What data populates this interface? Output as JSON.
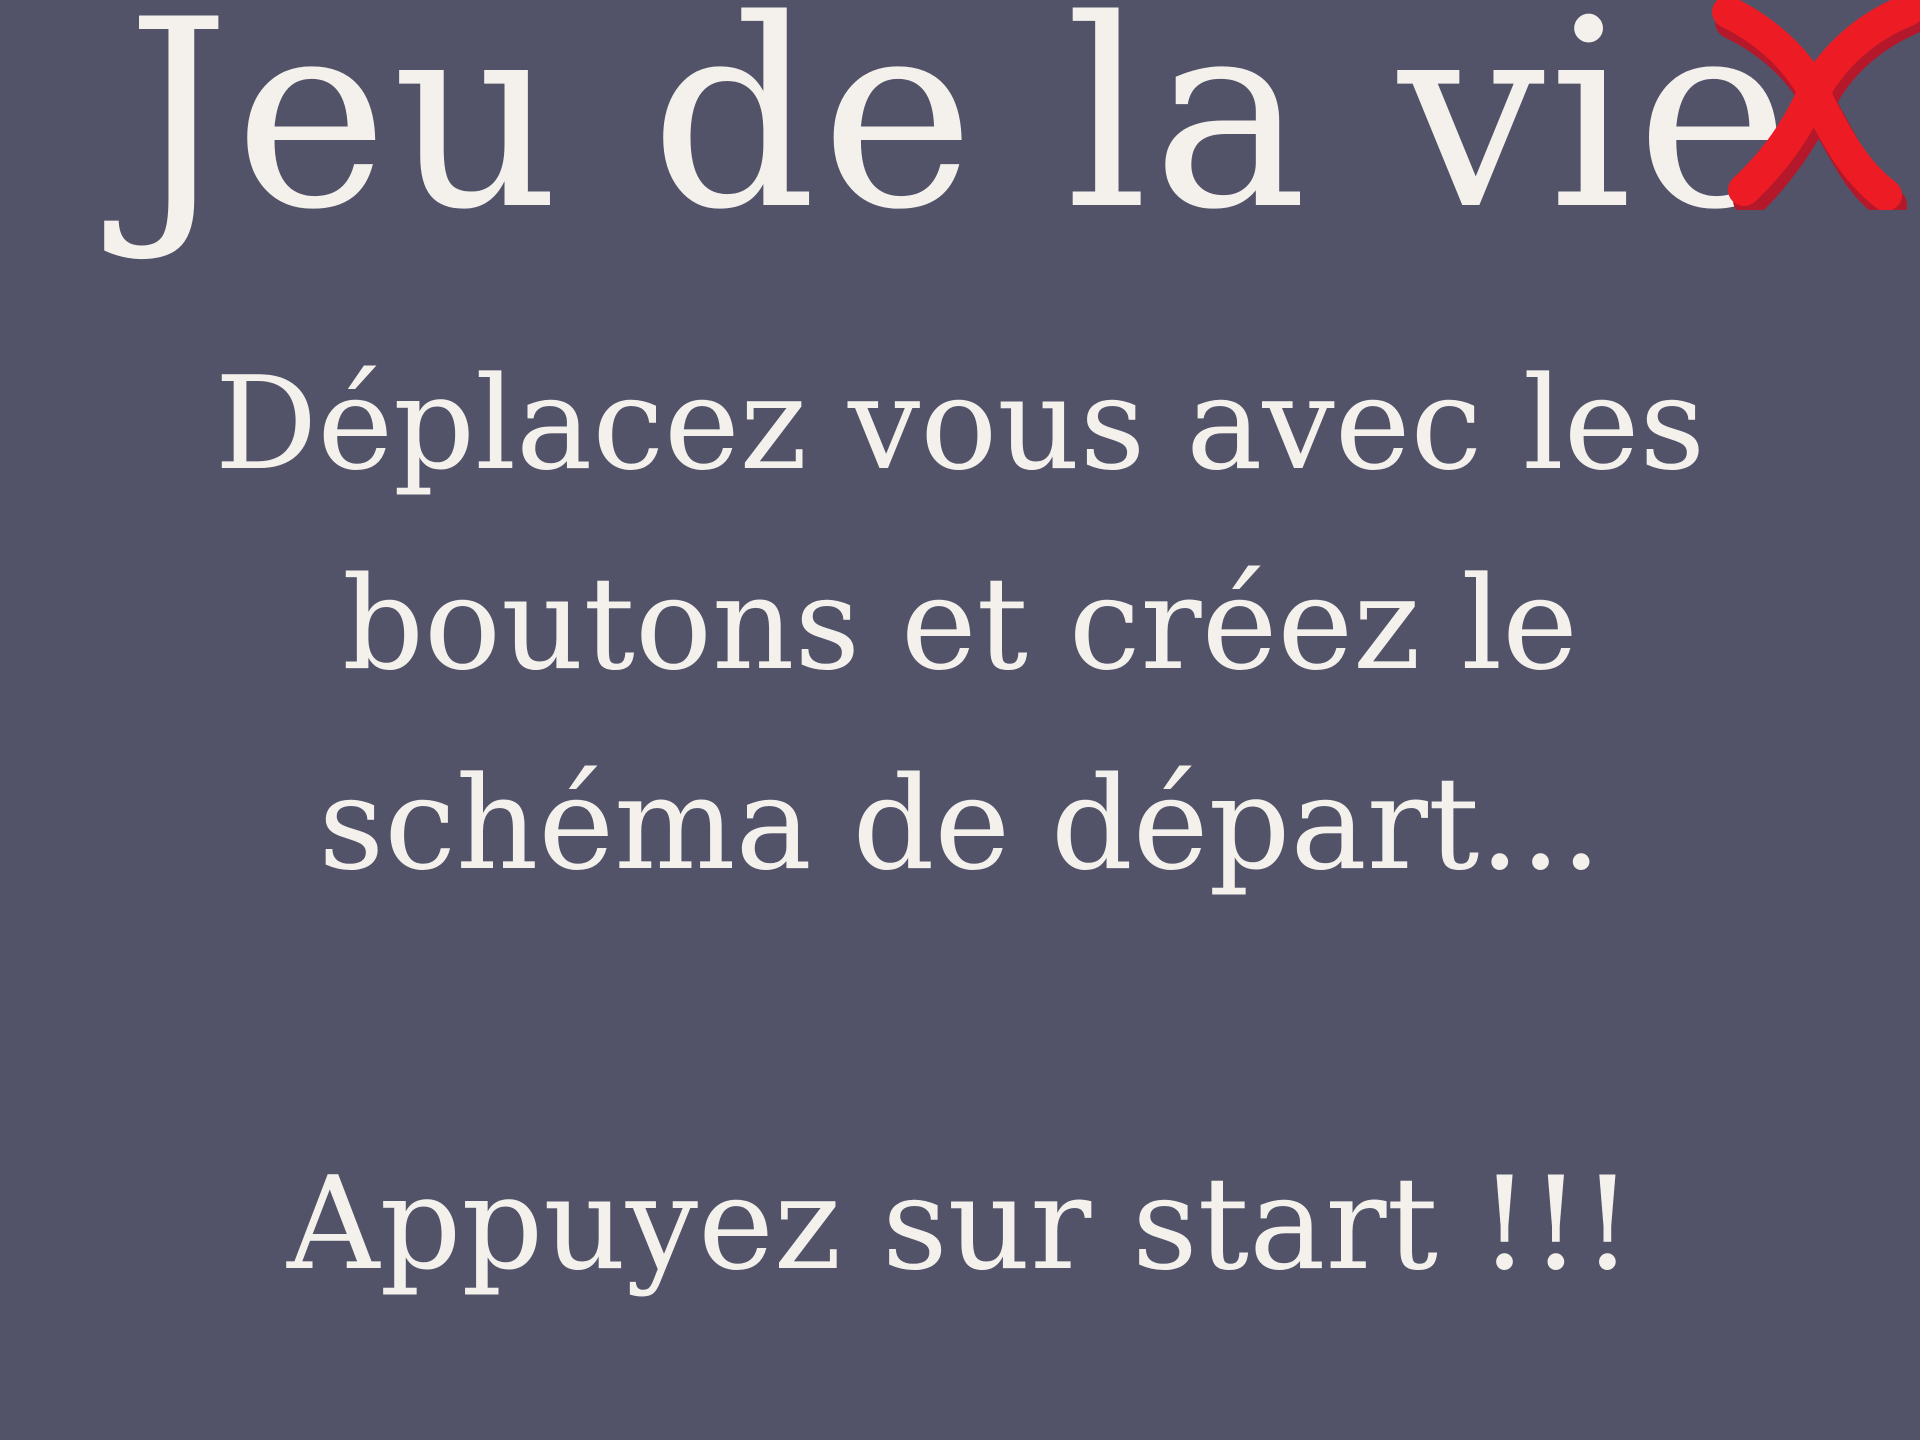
{
  "screen": {
    "title": "Jeu de la vie",
    "close_icon": "close-x-icon",
    "instructions": {
      "line1": "Déplacez vous avec les",
      "line2": "boutons et créez le",
      "line3": "schéma de départ..."
    },
    "start_prompt": "Appuyez sur start !!!"
  },
  "colors": {
    "background": "#525369",
    "text": "#F4F1EC",
    "close_red": "#ED1C24",
    "close_shadow": "#B5182B"
  }
}
